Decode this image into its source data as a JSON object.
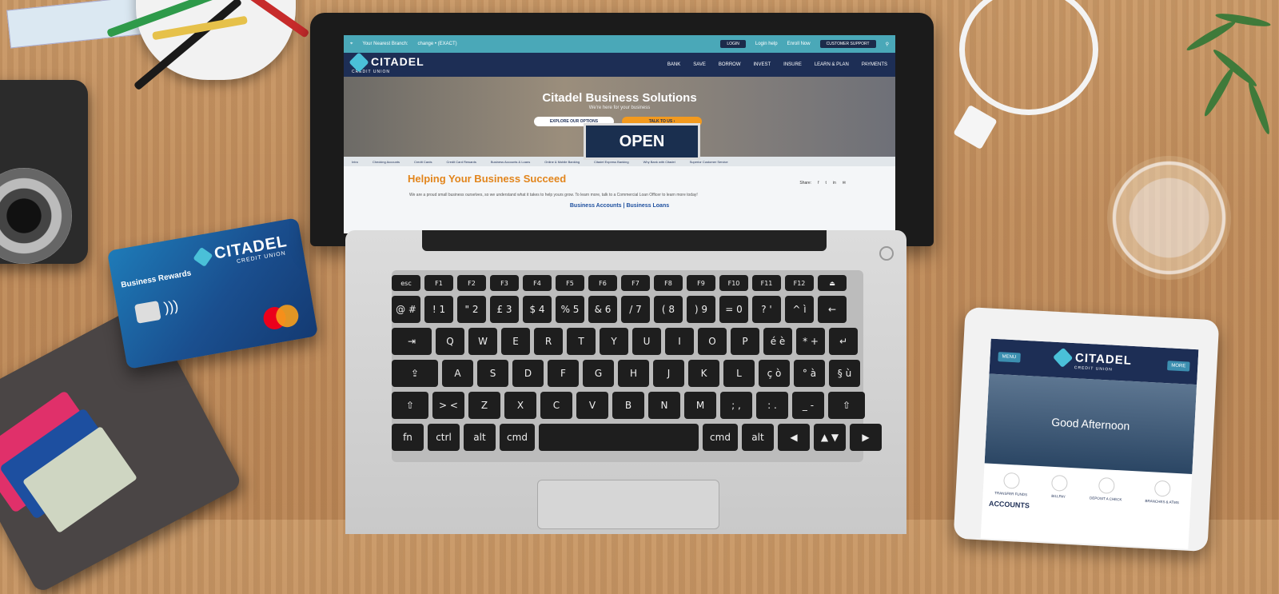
{
  "laptop_site": {
    "topbar": {
      "branch_label": "Your Nearest Branch:",
      "branch_change": "change • (EXACT)",
      "login": "LOGIN",
      "help_1": "Login help",
      "help_2": "Enroll Now",
      "customer_support": "CUSTOMER SUPPORT"
    },
    "brand": "CITADEL",
    "brand_sub": "CREDIT UNION",
    "nav": [
      "BANK",
      "SAVE",
      "BORROW",
      "INVEST",
      "INSURE",
      "LEARN & PLAN",
      "PAYMENTS"
    ],
    "hero": {
      "title": "Citadel Business Solutions",
      "tagline": "We're here for your business",
      "explore": "EXPLORE OUR OPTIONS",
      "talk": "TALK TO US ›",
      "sign": "OPEN"
    },
    "subnav": [
      "Intro",
      "Checking Accounts",
      "Credit Cards",
      "Credit Card Rewards",
      "Business Accounts & Loans",
      "Online & Mobile Banking",
      "Citadel Express Banking",
      "Why Bank with Citadel",
      "Superior Customer Service"
    ],
    "share_label": "Share:",
    "heading": "Helping Your Business Succeed",
    "body": "We are a proud small business ourselves, so we understand what it takes to help yours grow. To learn more, talk to a Commercial Loan Officer to learn more today!",
    "link_accounts": "Business Accounts",
    "link_sep": "|",
    "link_loans": "Business Loans"
  },
  "credit_card": {
    "brand": "CITADEL",
    "brand_sub": "CREDIT UNION",
    "tier": "Business Rewards",
    "network_colors": [
      "#eb001b",
      "#f79e1b"
    ]
  },
  "keyboard": {
    "fn_row": [
      "esc",
      "F1",
      "F2",
      "F3",
      "F4",
      "F5",
      "F6",
      "F7",
      "F8",
      "F9",
      "F10",
      "F11",
      "F12",
      "⏏"
    ],
    "row1": [
      "@ #",
      "! 1",
      "\" 2",
      "£ 3",
      "$ 4",
      "% 5",
      "& 6",
      "/ 7",
      "( 8",
      ") 9",
      "= 0",
      "? '",
      "^ ì",
      "←"
    ],
    "row2": [
      "⇥",
      "Q",
      "W",
      "E",
      "R",
      "T",
      "Y",
      "U",
      "I",
      "O",
      "P",
      "é è",
      "* +",
      "↵"
    ],
    "row3": [
      "⇪",
      "A",
      "S",
      "D",
      "F",
      "G",
      "H",
      "J",
      "K",
      "L",
      "ç ò",
      "° à",
      "§ ù"
    ],
    "row4": [
      "⇧",
      "> <",
      "Z",
      "X",
      "C",
      "V",
      "B",
      "N",
      "M",
      "; ,",
      ": .",
      "_ -",
      "⇧"
    ],
    "row5": [
      "fn",
      "ctrl",
      "alt",
      "cmd",
      "",
      "cmd",
      "alt",
      "◀",
      "▲ ▼",
      "▶"
    ]
  },
  "tablet_site": {
    "menu": "MENU",
    "more": "MORE",
    "brand": "CITADEL",
    "brand_sub": "CREDIT UNION",
    "greeting": "Good Afternoon",
    "quick_actions": [
      "TRANSFER FUNDS",
      "BILLPAY",
      "DEPOSIT A CHECK",
      "BRANCHES & ATMS"
    ],
    "accounts": "ACCOUNTS"
  }
}
